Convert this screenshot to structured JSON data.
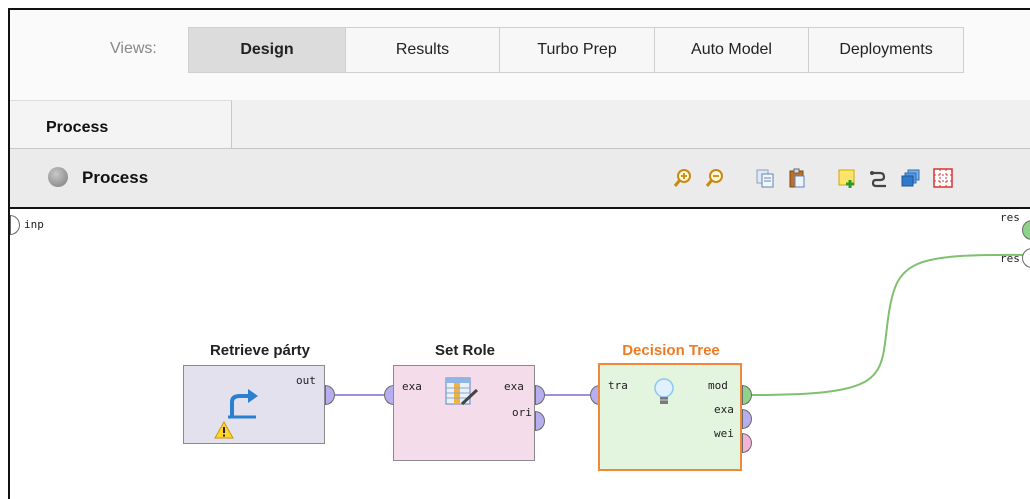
{
  "views": {
    "label": "Views:",
    "tabs": [
      "Design",
      "Results",
      "Turbo Prep",
      "Auto Model",
      "Deployments"
    ],
    "active": "Design"
  },
  "panel": {
    "tab_label": "Process"
  },
  "process_toolbar": {
    "title": "Process",
    "icons": [
      "zoom-in-icon",
      "zoom-out-icon",
      "copy-icon",
      "paste-icon",
      "add-note-icon",
      "auto-wire-icon",
      "layers-icon",
      "grid-icon"
    ]
  },
  "canvas": {
    "input_port": "inp",
    "result_ports": [
      "res",
      "res"
    ],
    "operators": [
      {
        "title": "Retrieve párty",
        "ports_out": [
          "out"
        ],
        "warning": true
      },
      {
        "title": "Set Role",
        "ports_in": [
          "exa"
        ],
        "ports_out": [
          "exa",
          "ori"
        ]
      },
      {
        "title": "Decision Tree",
        "ports_in": [
          "tra"
        ],
        "ports_out": [
          "mod",
          "exa",
          "wei"
        ],
        "selected": true
      }
    ]
  },
  "colors": {
    "retrieve_box": "#e4e1ee",
    "set_role_box": "#f4dcea",
    "decision_tree_box": "#e3f4df",
    "selected_border": "#f0883a",
    "selected_title": "#f07a22",
    "example_port": "#b7aef0",
    "model_port": "#8fd28a",
    "weights_port": "#f4b4da",
    "wire_example": "#9d8fe0",
    "wire_model": "#7ec06f"
  }
}
